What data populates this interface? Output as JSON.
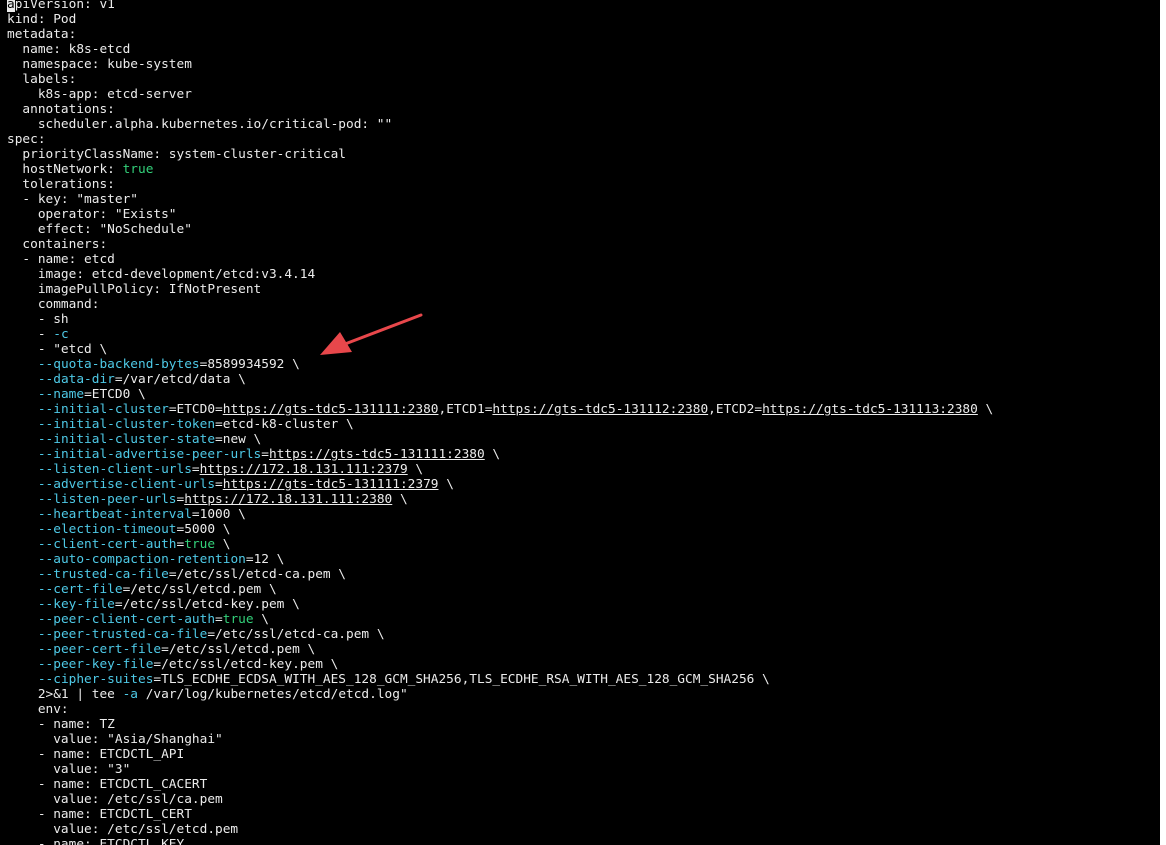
{
  "terminal": {
    "colors": {
      "background": "#000000",
      "text": "#ececec",
      "option": "#4ec9e6",
      "boolean": "#33d17a",
      "annotation_arrow": "#e8474b"
    },
    "lines": [
      [
        {
          "t": "a",
          "c": "cursor"
        },
        {
          "t": "piVersion: v1"
        }
      ],
      [
        {
          "t": "kind: Pod"
        }
      ],
      [
        {
          "t": "metadata:"
        }
      ],
      [
        {
          "t": "  name: k8s-etcd"
        }
      ],
      [
        {
          "t": "  namespace: kube-system"
        }
      ],
      [
        {
          "t": "  labels:"
        }
      ],
      [
        {
          "t": "    k8s-app: etcd-server"
        }
      ],
      [
        {
          "t": "  annotations:"
        }
      ],
      [
        {
          "t": "    scheduler.alpha.kubernetes.io/critical-pod: \"\""
        }
      ],
      [
        {
          "t": "spec:"
        }
      ],
      [
        {
          "t": "  priorityClassName: system-cluster-critical"
        }
      ],
      [
        {
          "t": "  hostNetwork: "
        },
        {
          "t": "true",
          "c": "bool"
        }
      ],
      [
        {
          "t": "  tolerations:"
        }
      ],
      [
        {
          "t": "  - key: \"master\""
        }
      ],
      [
        {
          "t": "    operator: \"Exists\""
        }
      ],
      [
        {
          "t": "    effect: \"NoSchedule\""
        }
      ],
      [
        {
          "t": "  containers:"
        }
      ],
      [
        {
          "t": "  - name: etcd"
        }
      ],
      [
        {
          "t": "    image: etcd-development/etcd:v3.4.14"
        }
      ],
      [
        {
          "t": "    imagePullPolicy: IfNotPresent"
        }
      ],
      [
        {
          "t": "    command:"
        }
      ],
      [
        {
          "t": "    - sh"
        }
      ],
      [
        {
          "t": "    - "
        },
        {
          "t": "-c",
          "c": "opt"
        }
      ],
      [
        {
          "t": "    - \"etcd \\"
        }
      ],
      [
        {
          "t": "    "
        },
        {
          "t": "--quota-backend-bytes",
          "c": "opt"
        },
        {
          "t": "=8589934592 \\"
        }
      ],
      [
        {
          "t": "    "
        },
        {
          "t": "--data-dir",
          "c": "opt"
        },
        {
          "t": "=/var/etcd/data \\"
        }
      ],
      [
        {
          "t": "    "
        },
        {
          "t": "--name",
          "c": "opt"
        },
        {
          "t": "=ETCD0 \\"
        }
      ],
      [
        {
          "t": "    "
        },
        {
          "t": "--initial-cluster",
          "c": "opt"
        },
        {
          "t": "=ETCD0="
        },
        {
          "t": "https://gts-tdc5-131111:2380",
          "c": "url"
        },
        {
          "t": ",ETCD1="
        },
        {
          "t": "https://gts-tdc5-131112:2380",
          "c": "url"
        },
        {
          "t": ",ETCD2="
        },
        {
          "t": "https://gts-tdc5-131113:2380",
          "c": "url"
        },
        {
          "t": " \\"
        }
      ],
      [
        {
          "t": "    "
        },
        {
          "t": "--initial-cluster-token",
          "c": "opt"
        },
        {
          "t": "=etcd-k8-cluster \\"
        }
      ],
      [
        {
          "t": "    "
        },
        {
          "t": "--initial-cluster-state",
          "c": "opt"
        },
        {
          "t": "=new \\"
        }
      ],
      [
        {
          "t": "    "
        },
        {
          "t": "--initial-advertise-peer-urls",
          "c": "opt"
        },
        {
          "t": "="
        },
        {
          "t": "https://gts-tdc5-131111:2380",
          "c": "url"
        },
        {
          "t": " \\"
        }
      ],
      [
        {
          "t": "    "
        },
        {
          "t": "--listen-client-urls",
          "c": "opt"
        },
        {
          "t": "="
        },
        {
          "t": "https://172.18.131.111:2379",
          "c": "url"
        },
        {
          "t": " \\"
        }
      ],
      [
        {
          "t": "    "
        },
        {
          "t": "--advertise-client-urls",
          "c": "opt"
        },
        {
          "t": "="
        },
        {
          "t": "https://gts-tdc5-131111:2379",
          "c": "url"
        },
        {
          "t": " \\"
        }
      ],
      [
        {
          "t": "    "
        },
        {
          "t": "--listen-peer-urls",
          "c": "opt"
        },
        {
          "t": "="
        },
        {
          "t": "https://172.18.131.111:2380",
          "c": "url"
        },
        {
          "t": " \\"
        }
      ],
      [
        {
          "t": "    "
        },
        {
          "t": "--heartbeat-interval",
          "c": "opt"
        },
        {
          "t": "=1000 \\"
        }
      ],
      [
        {
          "t": "    "
        },
        {
          "t": "--election-timeout",
          "c": "opt"
        },
        {
          "t": "=5000 \\"
        }
      ],
      [
        {
          "t": "    "
        },
        {
          "t": "--client-cert-auth",
          "c": "opt"
        },
        {
          "t": "="
        },
        {
          "t": "true",
          "c": "bool"
        },
        {
          "t": " \\"
        }
      ],
      [
        {
          "t": "    "
        },
        {
          "t": "--auto-compaction-retention",
          "c": "opt"
        },
        {
          "t": "=12 \\"
        }
      ],
      [
        {
          "t": "    "
        },
        {
          "t": "--trusted-ca-file",
          "c": "opt"
        },
        {
          "t": "=/etc/ssl/etcd-ca.pem \\"
        }
      ],
      [
        {
          "t": "    "
        },
        {
          "t": "--cert-file",
          "c": "opt"
        },
        {
          "t": "=/etc/ssl/etcd.pem \\"
        }
      ],
      [
        {
          "t": "    "
        },
        {
          "t": "--key-file",
          "c": "opt"
        },
        {
          "t": "=/etc/ssl/etcd-key.pem \\"
        }
      ],
      [
        {
          "t": "    "
        },
        {
          "t": "--peer-client-cert-auth",
          "c": "opt"
        },
        {
          "t": "="
        },
        {
          "t": "true",
          "c": "bool"
        },
        {
          "t": " \\"
        }
      ],
      [
        {
          "t": "    "
        },
        {
          "t": "--peer-trusted-ca-file",
          "c": "opt"
        },
        {
          "t": "=/etc/ssl/etcd-ca.pem \\"
        }
      ],
      [
        {
          "t": "    "
        },
        {
          "t": "--peer-cert-file",
          "c": "opt"
        },
        {
          "t": "=/etc/ssl/etcd.pem \\"
        }
      ],
      [
        {
          "t": "    "
        },
        {
          "t": "--peer-key-file",
          "c": "opt"
        },
        {
          "t": "=/etc/ssl/etcd-key.pem \\"
        }
      ],
      [
        {
          "t": "    "
        },
        {
          "t": "--cipher-suites",
          "c": "opt"
        },
        {
          "t": "=TLS_ECDHE_ECDSA_WITH_AES_128_GCM_SHA256,TLS_ECDHE_RSA_WITH_AES_128_GCM_SHA256 \\"
        }
      ],
      [
        {
          "t": "    2>&1 | tee "
        },
        {
          "t": "-a",
          "c": "opt"
        },
        {
          "t": " /var/log/kubernetes/etcd/etcd.log\""
        }
      ],
      [
        {
          "t": "    env:"
        }
      ],
      [
        {
          "t": "    - name: TZ"
        }
      ],
      [
        {
          "t": "      value: \"Asia/Shanghai\""
        }
      ],
      [
        {
          "t": "    - name: ETCDCTL_API"
        }
      ],
      [
        {
          "t": "      value: \"3\""
        }
      ],
      [
        {
          "t": "    - name: ETCDCTL_CACERT"
        }
      ],
      [
        {
          "t": "      value: /etc/ssl/ca.pem"
        }
      ],
      [
        {
          "t": "    - name: ETCDCTL_CERT"
        }
      ],
      [
        {
          "t": "      value: /etc/ssl/etcd.pem"
        }
      ],
      [
        {
          "t": "    - name: ETCDCTL_KEY"
        }
      ]
    ]
  }
}
